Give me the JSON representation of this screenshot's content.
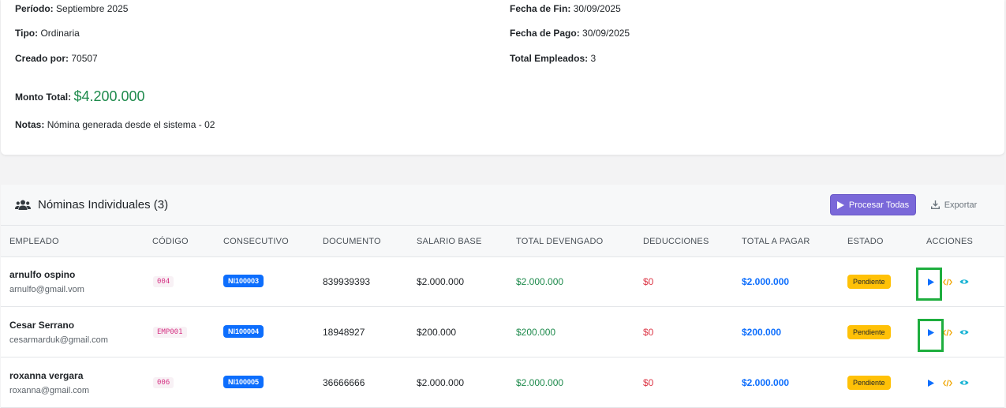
{
  "summary": {
    "periodo_label": "Período:",
    "periodo_value": "Septiembre 2025",
    "tipo_label": "Tipo:",
    "tipo_value": "Ordinaria",
    "creado_label": "Creado por:",
    "creado_value": "70507",
    "fecha_fin_label": "Fecha de Fin:",
    "fecha_fin_value": "30/09/2025",
    "fecha_pago_label": "Fecha de Pago:",
    "fecha_pago_value": "30/09/2025",
    "total_emp_label": "Total Empleados:",
    "total_emp_value": "3",
    "monto_label": "Monto Total:",
    "monto_value": "$4.200.000",
    "notas_label": "Notas:",
    "notas_value": "Nómina generada desde el sistema - 02"
  },
  "list": {
    "title": "Nóminas Individuales (3)",
    "process_label": "Procesar Todas",
    "export_label": "Exportar",
    "columns": [
      "EMPLEADO",
      "CÓDIGO",
      "CONSECUTIVO",
      "DOCUMENTO",
      "SALARIO BASE",
      "TOTAL DEVENGADO",
      "DEDUCCIONES",
      "TOTAL A PAGAR",
      "ESTADO",
      "ACCIONES"
    ],
    "rows": [
      {
        "name": "arnulfo ospino",
        "email": "arnulfo@gmail.vom",
        "code": "004",
        "consecutivo": "NI100003",
        "documento": "839939393",
        "salario": "$2.000.000",
        "devengado": "$2.000.000",
        "deducciones": "$0",
        "total": "$2.000.000",
        "estado": "Pendiente"
      },
      {
        "name": "Cesar Serrano",
        "email": "cesarmarduk@gmail.com",
        "code": "EMP001",
        "consecutivo": "NI100004",
        "documento": "18948927",
        "salario": "$200.000",
        "devengado": "$200.000",
        "deducciones": "$0",
        "total": "$200.000",
        "estado": "Pendiente"
      },
      {
        "name": "roxanna vergara",
        "email": "roxanna@gmail.com",
        "code": "006",
        "consecutivo": "NI100005",
        "documento": "36666666",
        "salario": "$2.000.000",
        "devengado": "$2.000.000",
        "deducciones": "$0",
        "total": "$2.000.000",
        "estado": "Pendiente"
      }
    ]
  },
  "colors": {
    "accent_purple": "#7a68d9",
    "money_green": "#1e8a4c",
    "deduction_red": "#dc3545",
    "total_blue": "#0d6efd",
    "pending_yellow": "#ffc107",
    "highlight_green": "#1eae3e"
  },
  "icons": {
    "header": "users-icon",
    "process": "play-icon",
    "export": "download-icon",
    "row_actions": [
      "play-icon",
      "code-icon",
      "eye-icon"
    ]
  }
}
